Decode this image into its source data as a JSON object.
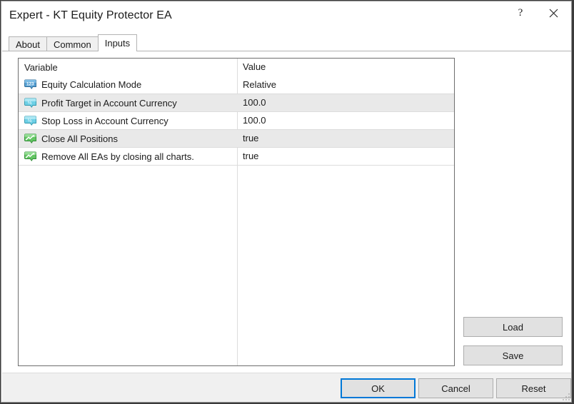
{
  "window": {
    "title": "Expert - KT Equity Protector EA",
    "help_icon": "question-mark-icon",
    "close_icon": "close-icon"
  },
  "tabs": [
    {
      "label": "About",
      "active": false
    },
    {
      "label": "Common",
      "active": false
    },
    {
      "label": "Inputs",
      "active": true
    }
  ],
  "table": {
    "headers": {
      "variable": "Variable",
      "value": "Value"
    },
    "rows": [
      {
        "icon": "integer-type-icon",
        "icon_glyph": "123",
        "variable": "Equity Calculation Mode",
        "value": "Relative"
      },
      {
        "icon": "double-type-icon",
        "icon_glyph": "½",
        "variable": "Profit Target in Account Currency",
        "value": "100.0"
      },
      {
        "icon": "double-type-icon",
        "icon_glyph": "½",
        "variable": "Stop Loss in Account Currency",
        "value": "100.0"
      },
      {
        "icon": "boolean-type-icon",
        "icon_glyph": "chart-line",
        "variable": "Close All Positions",
        "value": "true"
      },
      {
        "icon": "boolean-type-icon",
        "icon_glyph": "chart-line",
        "variable": "Remove All EAs by closing all charts.",
        "value": "true"
      }
    ]
  },
  "side_buttons": {
    "load": "Load",
    "save": "Save"
  },
  "footer_buttons": {
    "ok": "OK",
    "cancel": "Cancel",
    "reset": "Reset"
  },
  "colors": {
    "focus_border": "#0078d7",
    "integer_icon": "#4a9fd8",
    "double_icon": "#5bc8e0",
    "boolean_icon": "#5ec45e",
    "alt_row": "#e9e9e9",
    "button_face": "#e1e1e1"
  }
}
